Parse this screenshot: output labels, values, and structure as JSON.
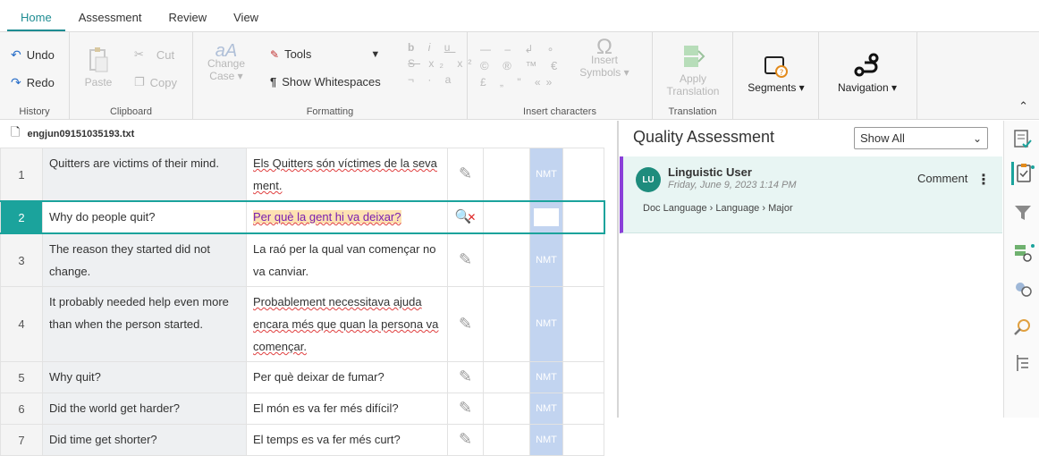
{
  "tabs": [
    {
      "label": "Home",
      "active": true
    },
    {
      "label": "Assessment"
    },
    {
      "label": "Review"
    },
    {
      "label": "View"
    }
  ],
  "ribbon": {
    "history": {
      "label": "History",
      "undo": "Undo",
      "redo": "Redo"
    },
    "clipboard": {
      "label": "Clipboard",
      "paste": "Paste",
      "cut": "Cut",
      "copy": "Copy"
    },
    "formatting": {
      "label": "Formatting",
      "change_case_1": "Change",
      "change_case_2": "Case",
      "tools": "Tools",
      "show_whitespaces": "Show Whitespaces"
    },
    "insert_characters": {
      "label": "Insert characters",
      "insert_symbols_1": "Insert",
      "insert_symbols_2": "Symbols"
    },
    "translation": {
      "label": "Translation",
      "apply_1": "Apply",
      "apply_2": "Translation"
    },
    "segments": {
      "label": "Segments"
    },
    "navigation": {
      "label": "Navigation"
    }
  },
  "file": {
    "name": "engjun09151035193.txt"
  },
  "segments": [
    {
      "num": "1",
      "source": "Quitters are victims of their mind.",
      "target": "Els Quitters són víctimes de la seva ment.",
      "mt": "NMT"
    },
    {
      "num": "2",
      "source": "Why do people quit?",
      "target": "Per què la gent hi va deixar?",
      "mt": ""
    },
    {
      "num": "3",
      "source": "The reason they started did not change.",
      "target": "La raó per la qual van començar no va canviar.",
      "mt": "NMT"
    },
    {
      "num": "4",
      "source": "It probably needed help even more than when the person started.",
      "target": "Probablement necessitava ajuda encara més que quan la persona va començar.",
      "mt": "NMT"
    },
    {
      "num": "5",
      "source": "Why quit?",
      "target": "Per què deixar de fumar?",
      "mt": "NMT"
    },
    {
      "num": "6",
      "source": "Did the world get harder?",
      "target": "El món es va fer més difícil?",
      "mt": "NMT"
    },
    {
      "num": "7",
      "source": "Did time get shorter?",
      "target": "El temps es va fer més curt?",
      "mt": "NMT"
    }
  ],
  "qa": {
    "title": "Quality Assessment",
    "filter": "Show All",
    "item": {
      "initials": "LU",
      "user": "Linguistic User",
      "date": "Friday, June 9, 2023 1:14 PM",
      "type": "Comment",
      "path": [
        "Doc Language",
        "Language",
        "Major"
      ]
    }
  },
  "colors": {
    "accent": "#1ba39c",
    "highlight": "#fde1b2",
    "mt_cell": "#c2d4f0",
    "qa_bar": "#8b3fd9"
  }
}
